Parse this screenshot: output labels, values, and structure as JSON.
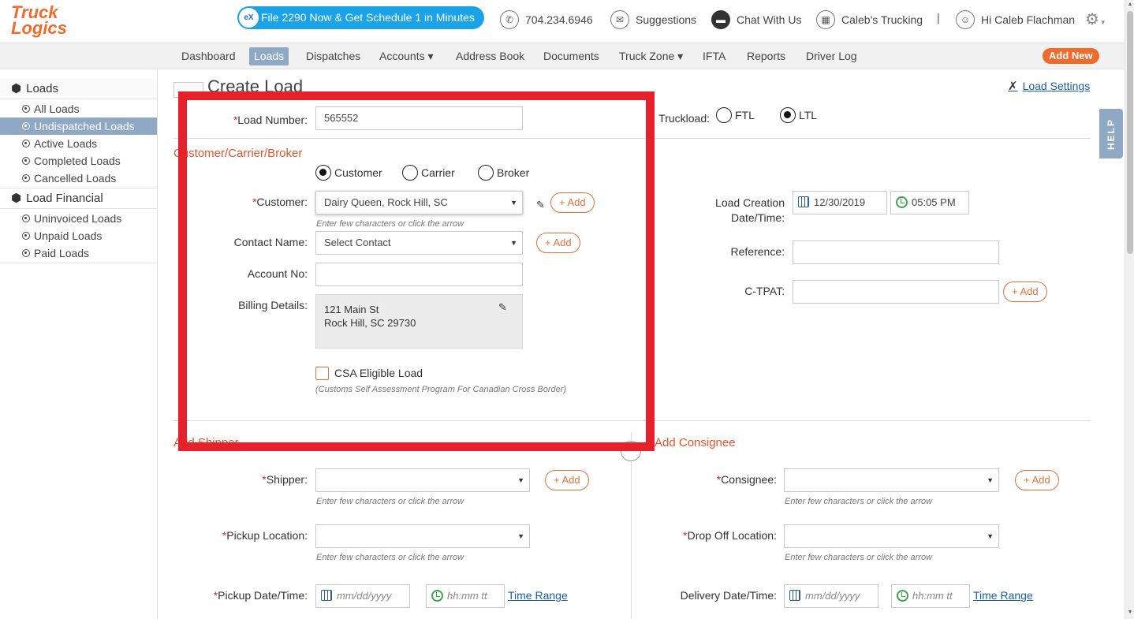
{
  "header": {
    "logo_line1": "Truck",
    "logo_line2": "Logics",
    "promo_badge": "eX",
    "promo_text": "File 2290 Now & Get Schedule 1 in Minutes",
    "phone": "704.234.6946",
    "suggestions": "Suggestions",
    "chat": "Chat With Us",
    "company": "Caleb's Trucking",
    "separator": "|",
    "user_greeting": "Hi Caleb Flachman"
  },
  "nav": {
    "items": [
      "Dashboard",
      "Loads",
      "Dispatches",
      "Accounts ▾",
      "Address Book",
      "Documents",
      "Truck Zone ▾",
      "IFTA",
      "Reports",
      "Driver Log"
    ],
    "active": "Loads",
    "add_new": "Add New"
  },
  "sidebar": {
    "loads_header": "Loads",
    "loads_items": [
      "All Loads",
      "Undispatched Loads",
      "Active Loads",
      "Completed Loads",
      "Cancelled Loads"
    ],
    "selected": "Undispatched Loads",
    "financial_header": "Load Financial",
    "financial_items": [
      "Uninvoiced Loads",
      "Unpaid Loads",
      "Paid Loads"
    ]
  },
  "page": {
    "title": "Create Load",
    "load_settings": "Load Settings",
    "help": "HELP"
  },
  "form": {
    "load_number_label": "Load Number:",
    "load_number_value": "565552",
    "truckload_label": "Truckload:",
    "ftl": "FTL",
    "ltl": "LTL",
    "ccb_section": "Customer/Carrier/Broker",
    "radio_customer": "Customer",
    "radio_carrier": "Carrier",
    "radio_broker": "Broker",
    "customer_label": "Customer:",
    "customer_value": "Dairy Queen, Rock Hill, SC",
    "hint": "Enter few characters or click the arrow",
    "add": "+ Add",
    "contact_label": "Contact Name:",
    "contact_value": "Select Contact",
    "account_label": "Account No:",
    "billing_label": "Billing Details:",
    "billing_line1": "121 Main St",
    "billing_line2": "Rock Hill, SC 29730",
    "csa_label": "CSA Eligible Load",
    "csa_note": "(Customs Self Assessment Program For Canadian Cross Border)",
    "creation_label_1": "Load Creation",
    "creation_label_2": "Date/Time:",
    "creation_date": "12/30/2019",
    "creation_time": "05:05 PM",
    "reference_label": "Reference:",
    "ctpat_label": "C-TPAT:",
    "shipper_section": "Add Shipper",
    "consignee_section": "Add Consignee",
    "shipper_label": "Shipper:",
    "consignee_label": "Consignee:",
    "pickup_location_label": "Pickup Location:",
    "dropoff_location_label": "Drop Off Location:",
    "pickup_datetime_label": "Pickup Date/Time:",
    "delivery_datetime_label": "Delivery Date/Time:",
    "date_placeholder": "mm/dd/yyyy",
    "time_placeholder": "hh:mm tt",
    "time_range": "Time Range",
    "required_mark": "*"
  },
  "colors": {
    "accent": "#f06a2a",
    "highlight_box": "#e62129",
    "nav_active": "#8fa8c3",
    "promo": "#1aa3e8",
    "link": "#1a5fa8"
  }
}
